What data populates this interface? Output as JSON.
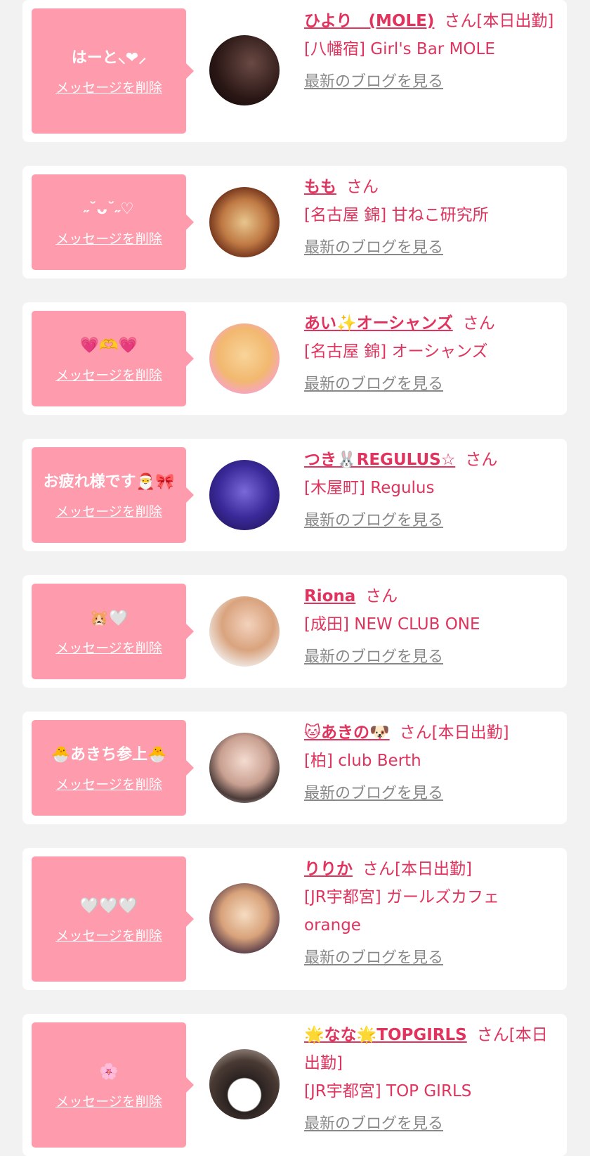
{
  "delete_label": "メッセージを削除",
  "blog_label": "最新のブログを見る",
  "colors": {
    "bubble": "#fe9bac",
    "accent": "#e0345e",
    "muted": "#888888",
    "background": "#f2f2f2"
  },
  "cards": [
    {
      "message": "はーと⸜❤︎⸝",
      "name": "ひより　(MOLE)",
      "suffix": "さん[本日出勤]",
      "shop": "[八幡宿] Girl's Bar MOLE"
    },
    {
      "message": "˶˘ᴗ˘˶♡",
      "name": "もも",
      "suffix": "さん",
      "shop": "[名古屋 錦] 甘ねこ研究所"
    },
    {
      "message": "💗🫶💗",
      "name": "あい✨オーシャンズ",
      "suffix": "さん",
      "shop": "[名古屋 錦] オーシャンズ"
    },
    {
      "message": "お疲れ様です🎅🎀",
      "name": "つき🐰REGULUS☆",
      "suffix": "さん",
      "shop": "[木屋町] Regulus"
    },
    {
      "message": "🐹🤍",
      "name": "Riona",
      "suffix": "さん",
      "shop": "[成田] NEW CLUB ONE"
    },
    {
      "message": "🐣あきち参上🐣",
      "name": "🐱あきの🐶",
      "suffix": "さん[本日出勤]",
      "shop": "[柏] club Berth"
    },
    {
      "message": "🤍🤍🤍",
      "name": "りりか",
      "suffix": "さん[本日出勤]",
      "shop": "[JR宇都宮] ガールズカフェ orange"
    },
    {
      "message": "🌸",
      "name": "🌟なな🌟TOPGIRLS",
      "suffix": "さん[本日出勤]",
      "shop": "[JR宇都宮] TOP GIRLS"
    }
  ]
}
